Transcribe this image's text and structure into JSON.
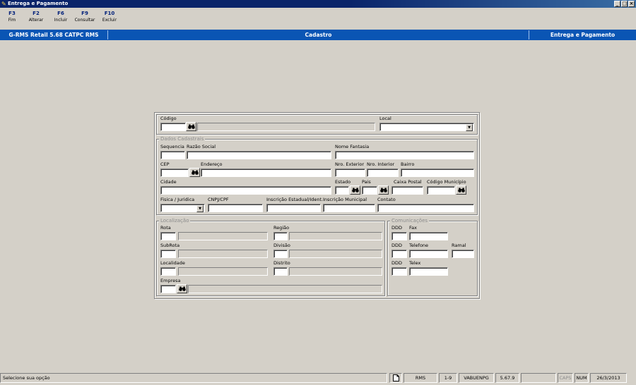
{
  "window": {
    "title": "Entrega e Pagamento",
    "buttons": {
      "minimize": "_",
      "maximize": "□",
      "close": "×"
    }
  },
  "toolbar": {
    "keys": [
      {
        "key": "F3",
        "label": "Fim"
      },
      {
        "key": "F2",
        "label": "Alterar"
      },
      {
        "key": "F6",
        "label": "Incluir"
      },
      {
        "key": "F9",
        "label": "Consultar"
      },
      {
        "key": "F10",
        "label": "Excluir"
      }
    ]
  },
  "header": {
    "product": "G-RMS Retail 5.68 CATPC RMS",
    "section": "Cadastro",
    "screen": "Entrega e Pagamento"
  },
  "form": {
    "codigo": "Código",
    "local": "Local",
    "dados_cadastrais": {
      "title": "Dados Cadastrais",
      "sequencia": "Sequencia",
      "razao_social": "Razão Social",
      "nome_fantasia": "Nome Fantasia",
      "cep": "CEP",
      "endereco": "Endereço",
      "nro_exterior": "Nro. Exterior",
      "nro_interior": "Nro. Interior",
      "bairro": "Bairro",
      "cidade": "Cidade",
      "estado": "Estado",
      "pais": "Pais",
      "caixa_postal": "Caixa Postal",
      "codigo_municipio": "Código Município",
      "fisica_juridica": "Fisica / Juridica",
      "cnpj_cpf": "CNPJ/CPF",
      "inscricao_estadual": "Inscrição Estadual/Ident.",
      "inscricao_municipal": "Inscrição Municipal",
      "contato": "Contato"
    },
    "localizacao": {
      "title": "Localização",
      "rota": "Rota",
      "regiao": "Região",
      "subrota": "SubRota",
      "divisao": "Divisão",
      "localidade": "Localidade",
      "distrito": "Distrito",
      "empresa": "Empresa"
    },
    "comunicacoes": {
      "title": "Comunicações",
      "ddd": "DDD",
      "fax": "Fax",
      "telefone": "Telefone",
      "ramal": "Ramal",
      "telex": "Telex"
    }
  },
  "statusbar": {
    "message": "Selecione sua opção",
    "system": "RMS",
    "position": "1-9",
    "program": "VABUENPG",
    "version": "5.67.9",
    "caps": "CAPS",
    "num": "NUM",
    "date": "26/3/2013"
  },
  "icons": {
    "lookup": "binoculars-icon",
    "dropdown": "chevron-down-icon",
    "app": "app-icon",
    "document": "document-icon"
  },
  "colors": {
    "titlebar": "#0a246a",
    "header": "#0a55b4",
    "face": "#d4d0c8",
    "field": "#ffffff"
  }
}
